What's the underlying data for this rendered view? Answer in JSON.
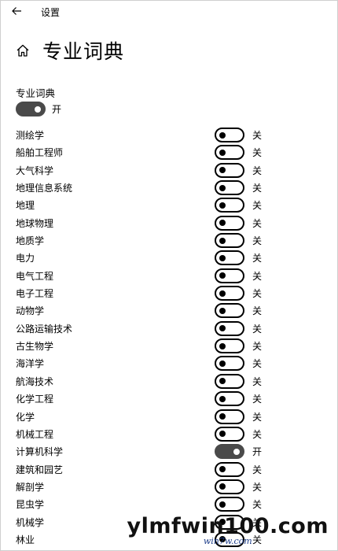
{
  "window": {
    "title": "设置"
  },
  "header": {
    "title": "专业词典"
  },
  "master": {
    "label": "专业词典",
    "state_text": "开",
    "on": true
  },
  "state_labels": {
    "on": "开",
    "off": "关"
  },
  "items": [
    {
      "label": "测绘学",
      "on": false
    },
    {
      "label": "船舶工程师",
      "on": false
    },
    {
      "label": "大气科学",
      "on": false
    },
    {
      "label": "地理信息系统",
      "on": false
    },
    {
      "label": "地理",
      "on": false
    },
    {
      "label": "地球物理",
      "on": false
    },
    {
      "label": "地质学",
      "on": false
    },
    {
      "label": "电力",
      "on": false
    },
    {
      "label": "电气工程",
      "on": false
    },
    {
      "label": "电子工程",
      "on": false
    },
    {
      "label": "动物学",
      "on": false
    },
    {
      "label": "公路运输技术",
      "on": false
    },
    {
      "label": "古生物学",
      "on": false
    },
    {
      "label": "海洋学",
      "on": false
    },
    {
      "label": "航海技术",
      "on": false
    },
    {
      "label": "化学工程",
      "on": false
    },
    {
      "label": "化学",
      "on": false
    },
    {
      "label": "机械工程",
      "on": false
    },
    {
      "label": "计算机科学",
      "on": true
    },
    {
      "label": "建筑和园艺",
      "on": false
    },
    {
      "label": "解剖学",
      "on": false
    },
    {
      "label": "昆虫学",
      "on": false
    },
    {
      "label": "机械学",
      "on": false
    },
    {
      "label": "林业",
      "on": false
    }
  ],
  "watermark": {
    "main": "ylmfwin100.com",
    "sub": "win7w.com"
  },
  "icons": {
    "back": "back-arrow-icon",
    "home": "home-icon"
  }
}
